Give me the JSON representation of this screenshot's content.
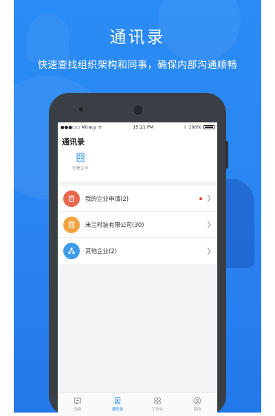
{
  "hero": {
    "title": "通讯录",
    "subtitle": "快速查找组织架构和同事，确保内部沟通顺畅"
  },
  "status_bar": {
    "carrier": "●●●○○ Miracy",
    "time": "15:21 PM",
    "battery": "100%"
  },
  "page": {
    "title": "通讯录",
    "create_label": "创建企业"
  },
  "list": [
    {
      "label": "我的企业申请(2)",
      "icon": "document-icon",
      "color": "#e8664d",
      "has_dot": true
    },
    {
      "label": "米兰时装有限公司(30)",
      "icon": "building-icon",
      "color": "#f2a341",
      "has_dot": false
    },
    {
      "label": "其他企业(2)",
      "icon": "org-icon",
      "color": "#3f9be8",
      "has_dot": false
    }
  ],
  "tabs": [
    {
      "label": "消息",
      "icon": "message-icon",
      "active": false
    },
    {
      "label": "通讯录",
      "icon": "contacts-icon",
      "active": true
    },
    {
      "label": "工作台",
      "icon": "grid-icon",
      "active": false
    },
    {
      "label": "我的",
      "icon": "user-icon",
      "active": false
    }
  ],
  "colors": {
    "brand_blue": "#2a8cf5",
    "red_dot": "#e53935"
  }
}
